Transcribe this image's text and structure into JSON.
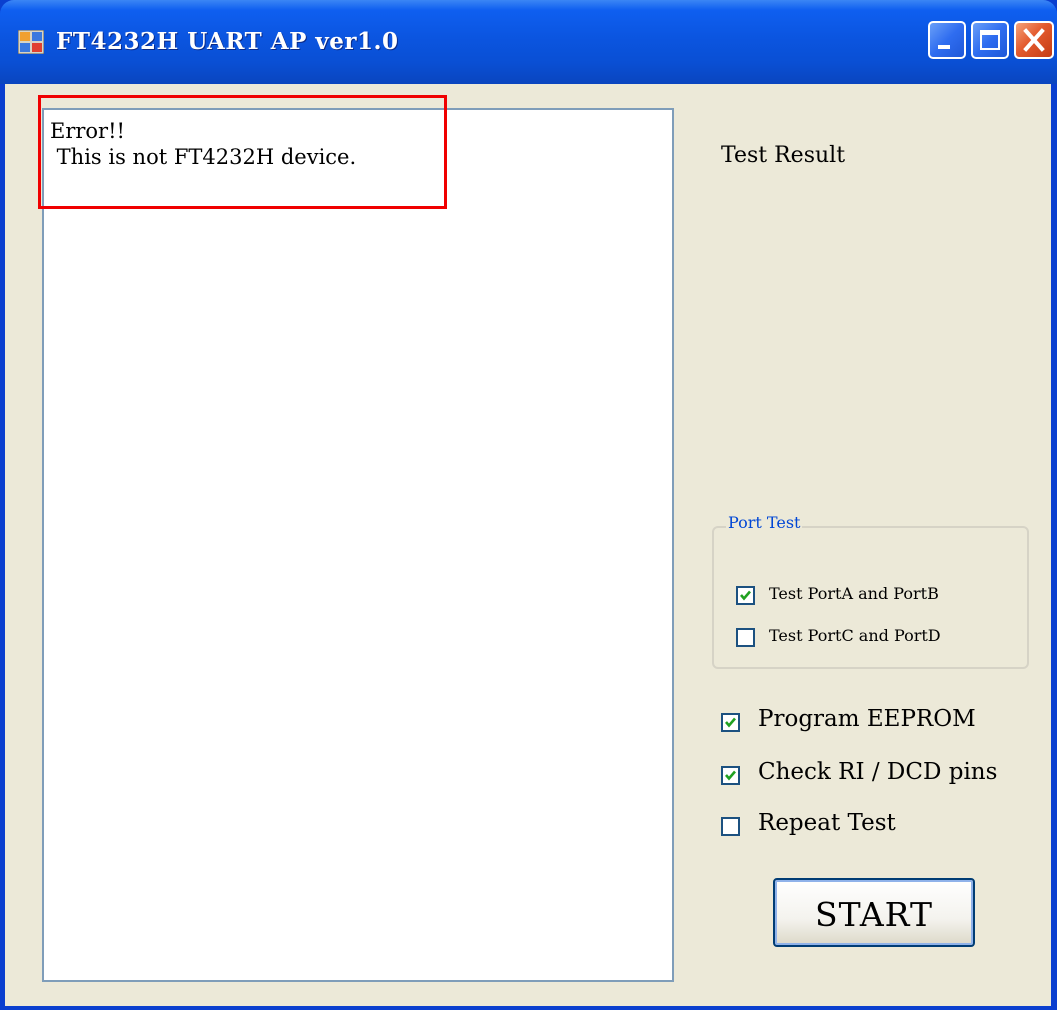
{
  "window": {
    "title": "FT4232H UART AP ver1.0"
  },
  "output": {
    "lines": "Error!!\n This is not FT4232H device."
  },
  "test_result_label": "Test Result",
  "port_test": {
    "group_label": "Port Test",
    "items": [
      {
        "label": "Test PortA and PortB",
        "checked": true
      },
      {
        "label": "Test PortC and PortD",
        "checked": false
      }
    ]
  },
  "options": [
    {
      "label": "Program EEPROM",
      "checked": true
    },
    {
      "label": "Check RI / DCD pins",
      "checked": true
    },
    {
      "label": "Repeat Test",
      "checked": false
    }
  ],
  "start_button": {
    "label": "START"
  },
  "colors": {
    "titlebar": "#0a55e0",
    "client_bg": "#ece9d8",
    "highlight": "#f00000",
    "group_label": "#0046d5",
    "check": "#21a121"
  },
  "icons": [
    "app-icon",
    "minimize-icon",
    "maximize-icon",
    "close-icon",
    "checkmark-icon"
  ]
}
